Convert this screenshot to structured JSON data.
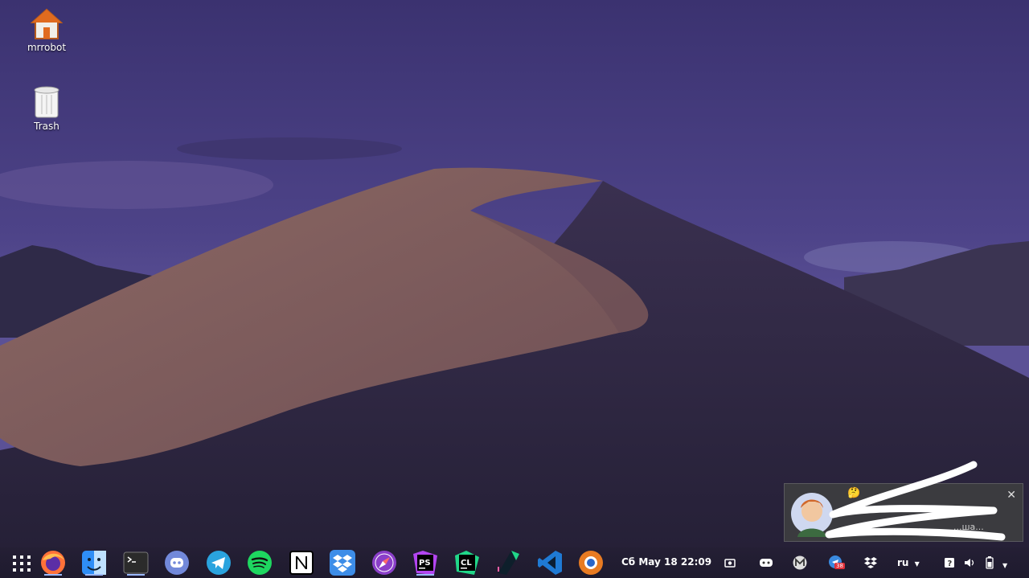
{
  "desktop": {
    "icons": [
      {
        "label": "mrrobot",
        "icon": "home-folder-icon"
      },
      {
        "label": "Trash",
        "icon": "trash-icon"
      }
    ]
  },
  "notification": {
    "emoji": "🤔",
    "body_line1": "...но",
    "body_line2": "...ша..."
  },
  "dock": {
    "apps": [
      {
        "name": "app-grid-icon"
      },
      {
        "name": "firefox-icon"
      },
      {
        "name": "finder-files-icon"
      },
      {
        "name": "terminal-icon"
      },
      {
        "name": "discord-icon"
      },
      {
        "name": "telegram-icon"
      },
      {
        "name": "spotify-icon"
      },
      {
        "name": "notion-icon"
      },
      {
        "name": "dropbox-icon"
      },
      {
        "name": "compass-browser-icon"
      },
      {
        "name": "phpstorm-icon"
      },
      {
        "name": "clion-icon"
      },
      {
        "name": "pycharm-icon"
      },
      {
        "name": "vscode-icon"
      },
      {
        "name": "ubuntu-orange-icon"
      }
    ],
    "ps_label": "PS",
    "cl_label": "CL"
  },
  "clock": {
    "text": "Сб May 18  22:09"
  },
  "tray": {
    "lang": "ru",
    "mail_badge": "38",
    "icons": [
      "screenshot-icon",
      "discord-tray-icon",
      "gmail-tray-icon",
      "mail-tray-icon",
      "dropbox-tray-icon",
      "notes-tray-icon",
      "volume-icon",
      "battery-icon",
      "menu-arrow-icon"
    ]
  },
  "colors": {
    "sky_top": "#3d3470",
    "sky_mid": "#5a4e94",
    "dune_light": "#8a6560",
    "dune_shadow": "#2e2740"
  }
}
